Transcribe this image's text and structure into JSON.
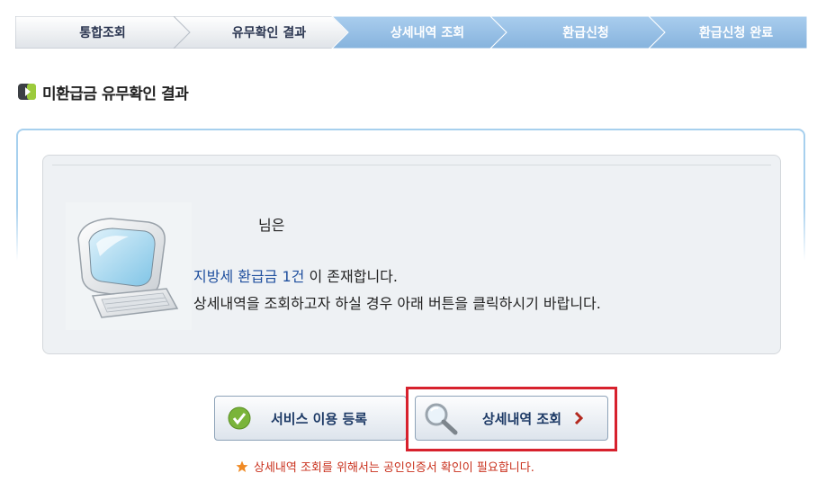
{
  "steps": [
    {
      "label": "통합조회",
      "state": "done"
    },
    {
      "label": "유무확인 결과",
      "state": "current"
    },
    {
      "label": "상세내역 조회",
      "state": "todo"
    },
    {
      "label": "환급신청",
      "state": "todo"
    },
    {
      "label": "환급신청 완료",
      "state": "todo"
    }
  ],
  "heading": "미환급금 유무확인 결과",
  "message": {
    "line1": "님은",
    "line2_highlight": "지방세 환급금 1건",
    "line2_rest": " 이 존재합니다.",
    "line3": "상세내역을 조회하고자 하실 경우 아래 버튼을 클릭하시기 바랍니다."
  },
  "buttons": {
    "register": "서비스 이용 등록",
    "detail": "상세내역 조회"
  },
  "note": "상세내역 조회를 위해서는 공인인증서 확인이 필요합니다.",
  "colors": {
    "step_done": "#e7eaef",
    "step_todo": "#93bde3",
    "panel_border": "#a7d0ee",
    "highlight_text": "#1f4f9e",
    "red_frame": "#d7212d",
    "note_text": "#c9301c"
  }
}
